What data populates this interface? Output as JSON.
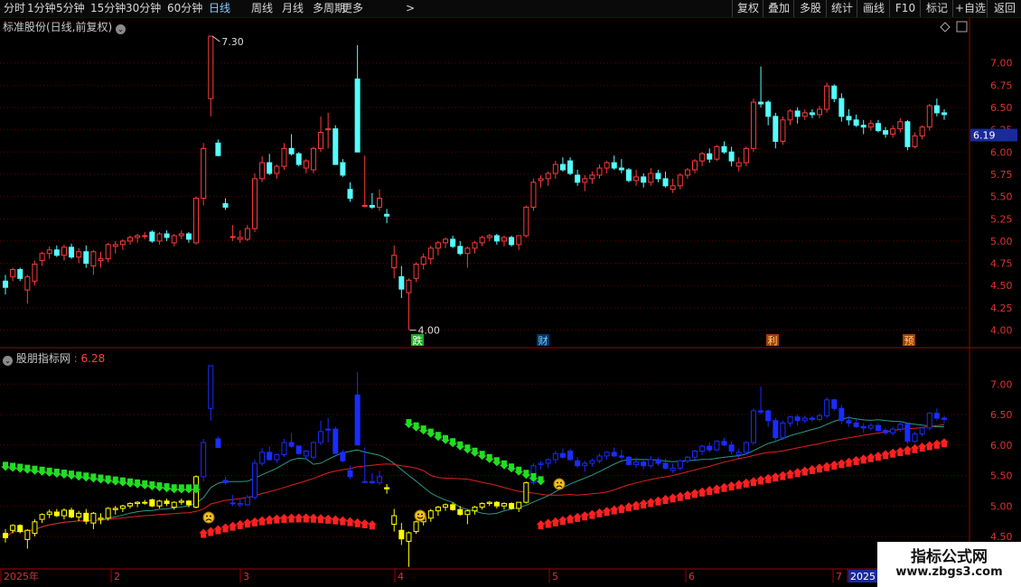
{
  "toolbar": {
    "periods": [
      "分时",
      "1分钟",
      "5分钟",
      "15分钟",
      "30分钟",
      "60分钟",
      "日线",
      "周线",
      "月线",
      "多周期",
      "更多"
    ],
    "active": "日线",
    "more_arrow": ">",
    "right": [
      "复权",
      "叠加",
      "多股",
      "统计",
      "画线",
      "F10",
      "标记",
      "+自选",
      "返回"
    ]
  },
  "main_panel": {
    "title": "标准股份(日线,前复权)",
    "price_scale": [
      "7.00",
      "6.75",
      "6.50",
      "6.25",
      "6.00",
      "5.75",
      "5.50",
      "5.25",
      "5.00",
      "4.75",
      "4.50",
      "4.25",
      "4.00"
    ],
    "current_price": "6.19",
    "high_label": "7.30",
    "low_label": "4.00",
    "markers": [
      "跌",
      "财",
      "利",
      "预"
    ]
  },
  "indicator_panel": {
    "name": "股朋指标网",
    "value": "6.28",
    "scale": [
      "7.00",
      "6.50",
      "6.00",
      "5.50",
      "5.00",
      "4.50"
    ]
  },
  "date_axis": [
    "2025年",
    "2",
    "3",
    "4",
    "5",
    "6",
    "7",
    "2025"
  ],
  "watermark": {
    "title": "指标公式网",
    "url": "www.zbgs3.com"
  },
  "colors": {
    "up": "#ff3a3a",
    "down": "#54ffff",
    "ind_down": "#1a2cff",
    "ind_yellow": "#ffff00",
    "green_arrow": "#22dd22",
    "red_arrow": "#ff2020",
    "ma_red": "#e02020",
    "ma_teal": "#2a9a8a",
    "grid": "#6a0000",
    "border": "#a00000"
  },
  "icons": [
    "settings-circle-icon",
    "diamond-icon",
    "window-icon",
    "up-arrow-icon",
    "down-arrow-icon",
    "sad-face-icon",
    "happy-face-icon"
  ]
}
